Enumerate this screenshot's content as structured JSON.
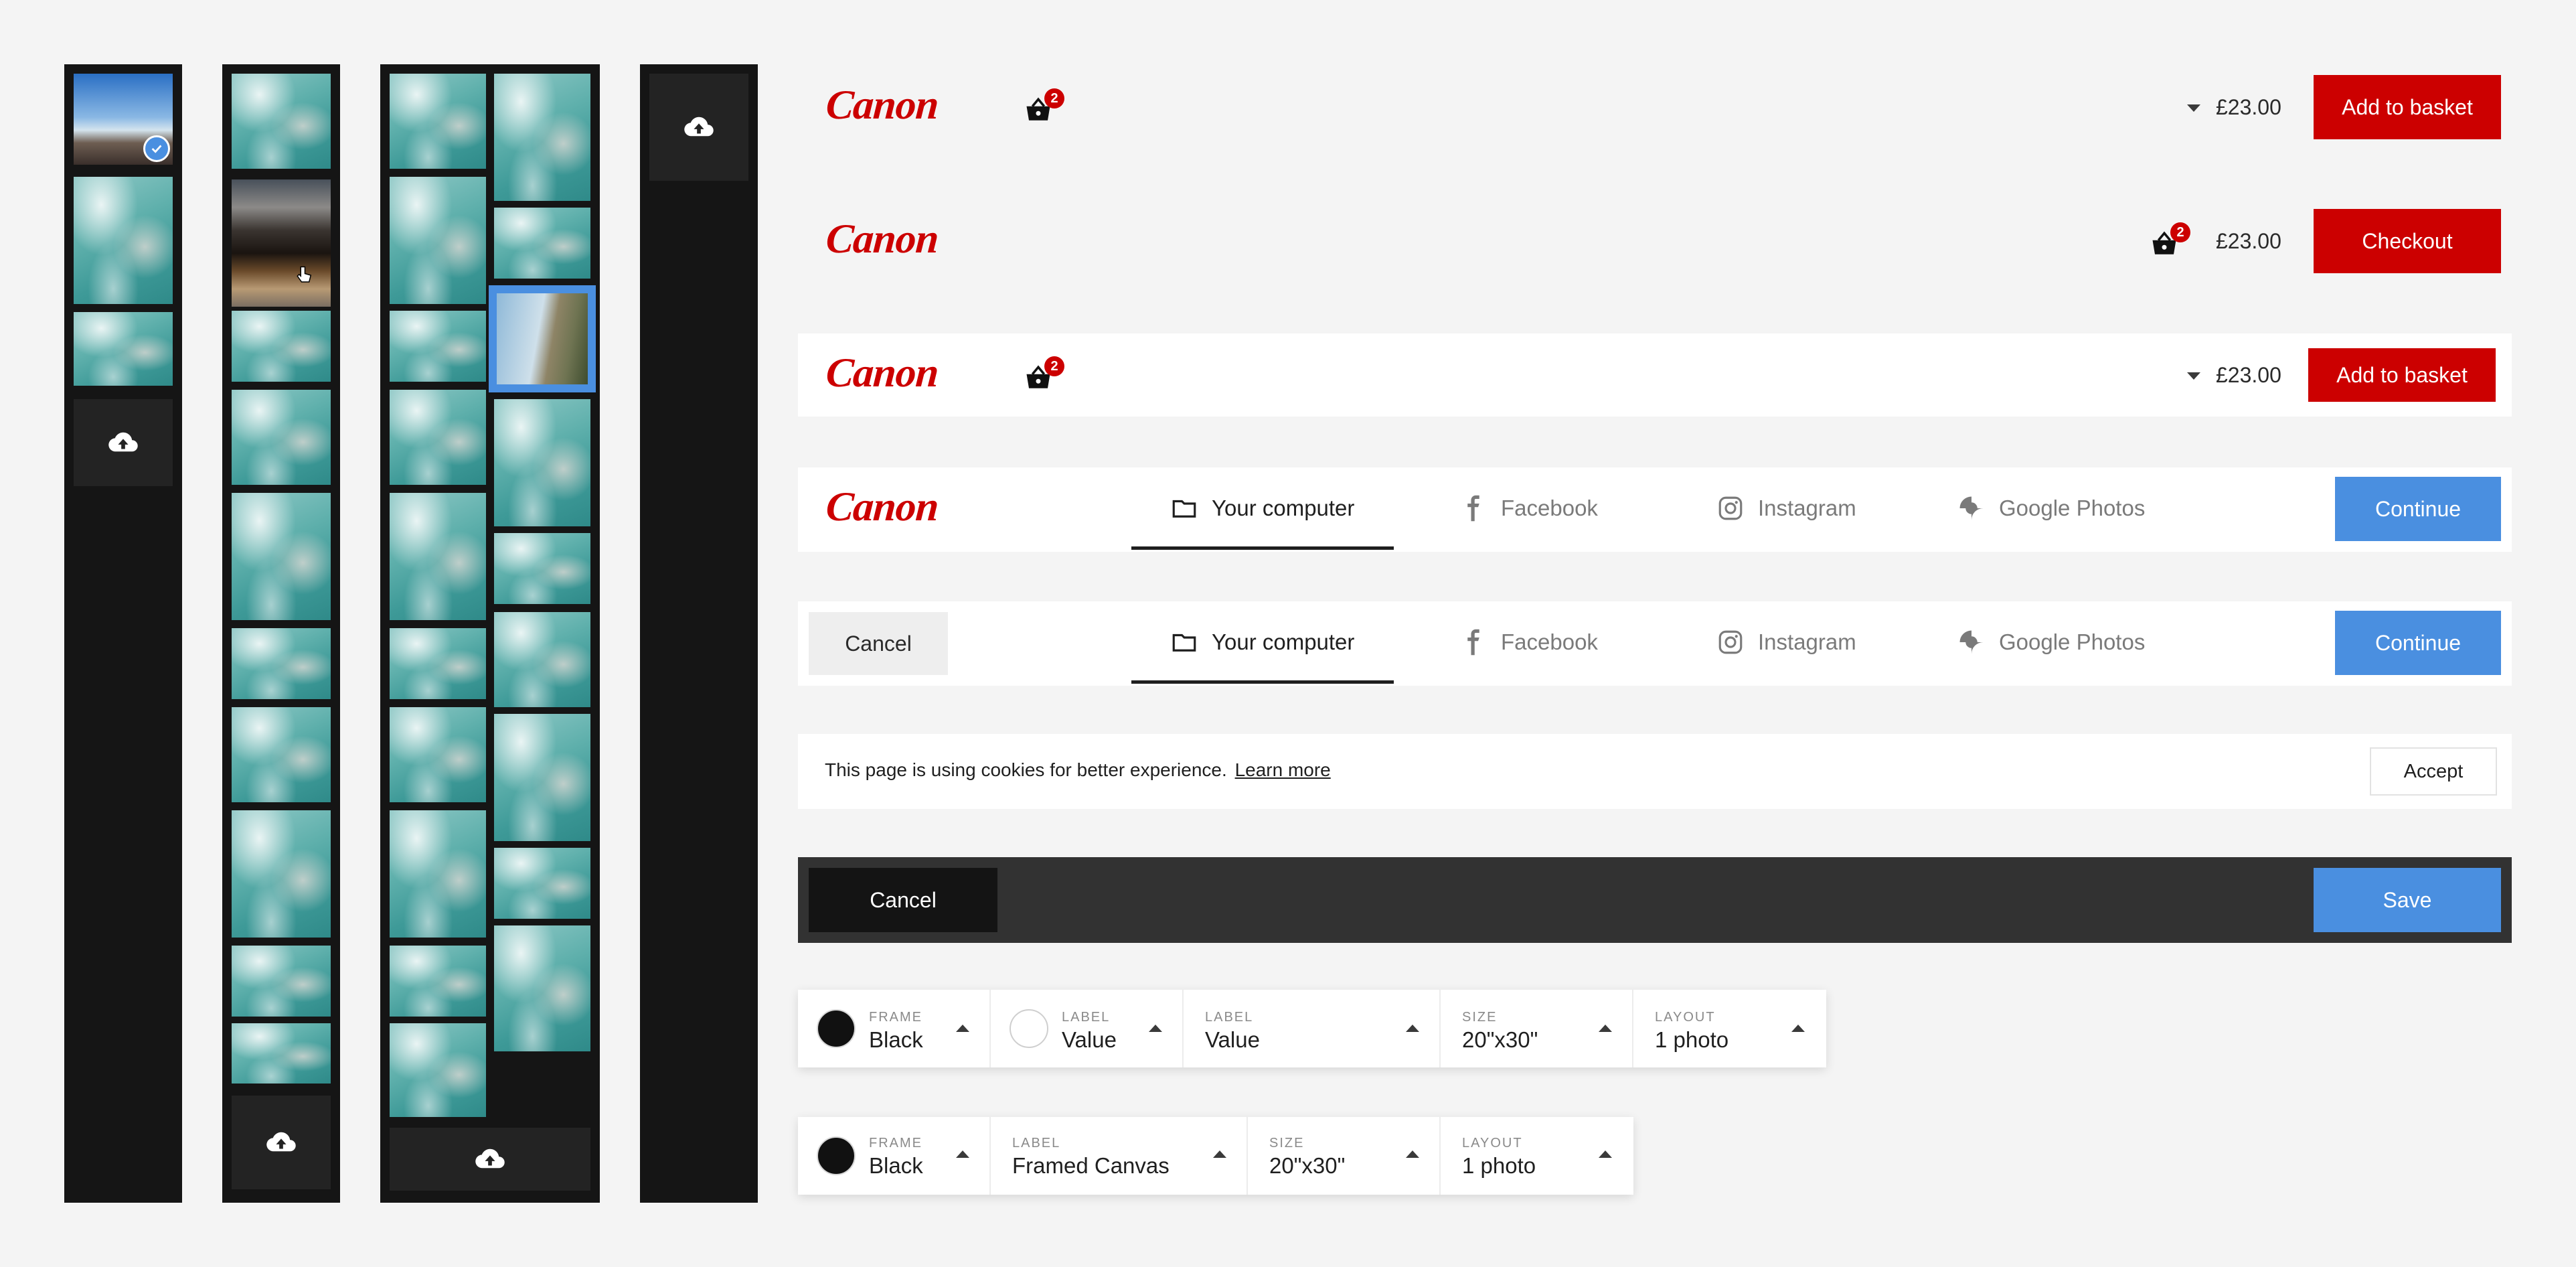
{
  "brand": {
    "logo_text": "Canon",
    "red": "#cc0000",
    "blue": "#4a8fe0"
  },
  "bar1": {
    "price": "£23.00",
    "cta": "Add to basket",
    "basket_count": "2"
  },
  "bar2": {
    "price": "£23.00",
    "cta": "Checkout",
    "basket_count": "2"
  },
  "bar3": {
    "price": "£23.00",
    "cta": "Add to basket",
    "basket_count": "2"
  },
  "source_tabs": [
    {
      "label": "Your computer",
      "icon": "folder-icon"
    },
    {
      "label": "Facebook",
      "icon": "facebook-icon"
    },
    {
      "label": "Instagram",
      "icon": "instagram-icon"
    },
    {
      "label": "Google Photos",
      "icon": "google-photos-icon"
    }
  ],
  "bar4": {
    "continue": "Continue"
  },
  "bar5": {
    "cancel": "Cancel",
    "continue": "Continue"
  },
  "cookie": {
    "text": "This page is using cookies for better experience.",
    "link": "Learn more",
    "accept": "Accept"
  },
  "editbar": {
    "cancel": "Cancel",
    "save": "Save"
  },
  "selectors1": [
    {
      "label": "FRAME",
      "value": "Black",
      "swatch": "#111111"
    },
    {
      "label": "LABEL",
      "value": "Value",
      "swatch": "#ffffff"
    },
    {
      "label": "LABEL",
      "value": "Value"
    },
    {
      "label": "SIZE",
      "value": "20\"x30\""
    },
    {
      "label": "LAYOUT",
      "value": "1 photo"
    }
  ],
  "selectors2": [
    {
      "label": "FRAME",
      "value": "Black",
      "swatch": "#111111"
    },
    {
      "label": "LABEL",
      "value": "Framed Canvas"
    },
    {
      "label": "SIZE",
      "value": "20\"x30\""
    },
    {
      "label": "LAYOUT",
      "value": "1 photo"
    }
  ]
}
